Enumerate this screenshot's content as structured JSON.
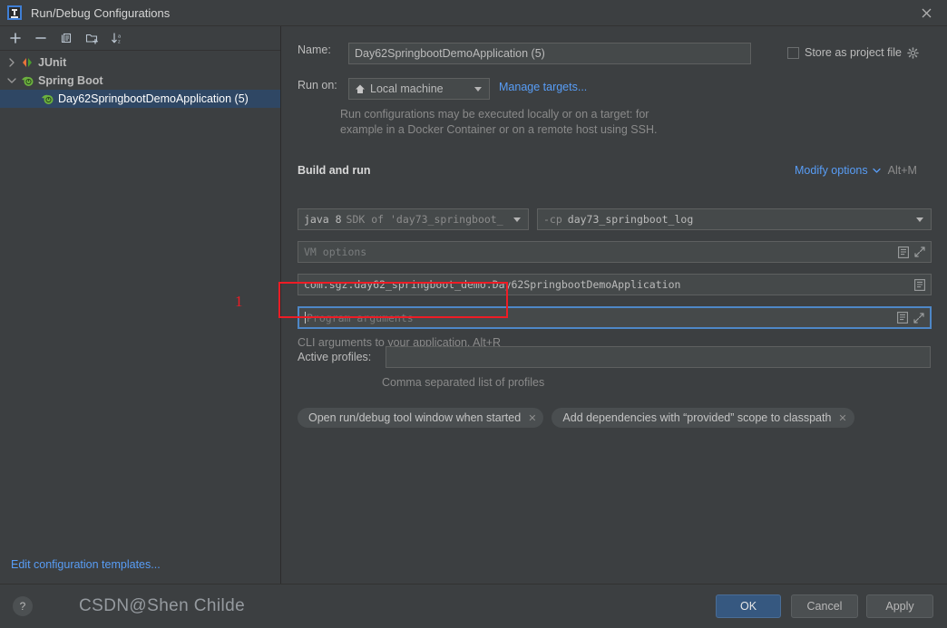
{
  "window": {
    "title": "Run/Debug Configurations",
    "logo_icon": "intellij-idea-icon",
    "close_icon": "close-icon"
  },
  "sidebar": {
    "toolbar": [
      {
        "name": "add-configuration-button",
        "icon": "plus-icon",
        "label": "+"
      },
      {
        "name": "remove-configuration-button",
        "icon": "minus-icon",
        "label": "−"
      },
      {
        "name": "copy-configuration-button",
        "icon": "copy-icon",
        "label": ""
      },
      {
        "name": "move-into-folder-button",
        "icon": "new-folder-icon",
        "label": ""
      },
      {
        "name": "sort-configurations-button",
        "icon": "sort-az-icon",
        "label": ""
      }
    ],
    "tree": [
      {
        "label": "JUnit",
        "icon": "junit-icon",
        "expanded": false,
        "twisty": "›",
        "level": 0,
        "selected": false
      },
      {
        "label": "Spring Boot",
        "icon": "spring-boot-icon",
        "expanded": true,
        "twisty": "⌄",
        "level": 0,
        "selected": false
      },
      {
        "label": "Day62SpringbootDemoApplication (5)",
        "icon": "spring-boot-icon",
        "expanded": null,
        "twisty": "",
        "level": 1,
        "selected": true
      }
    ],
    "edit_templates_link": "Edit configuration templates..."
  },
  "form": {
    "name_label": "Name:",
    "name_value": "Day62SpringbootDemoApplication (5)",
    "store_as_project_file_label": "Store as project file",
    "store_as_project_file_checked": false,
    "store_gear_icon": "gear-icon",
    "run_on_label": "Run on:",
    "run_on_value": "Local machine",
    "run_on_icon": "home-icon",
    "manage_targets_link": "Manage targets...",
    "run_on_hint_line1": "Run configurations may be executed locally or on a target: for",
    "run_on_hint_line2": "example in a Docker Container or on a remote host using SSH.",
    "build_and_run_title": "Build and run",
    "modify_options_link": "Modify options",
    "modify_options_shortcut": "Alt+M",
    "sdk_value_prefix": "java 8",
    "sdk_value_suffix": "SDK of 'day73_springboot_",
    "classpath_prefix": "-cp",
    "classpath_value": "day73_springboot_log",
    "vm_options_placeholder": "VM options",
    "vm_options_value": "",
    "main_class_value": "com.sgz.day62_springboot_demo.Day62SpringbootDemoApplication",
    "program_arguments_placeholder": "Program arguments",
    "program_arguments_value": "",
    "program_arguments_hint": "CLI arguments to your application. Alt+R",
    "active_profiles_label": "Active profiles:",
    "active_profiles_value": "",
    "active_profiles_hint": "Comma separated list of profiles",
    "chips": [
      {
        "label": "Open run/debug tool window when started",
        "close_icon": "close-small-icon"
      },
      {
        "label": "Add dependencies with “provided” scope to classpath",
        "close_icon": "close-small-icon"
      }
    ],
    "macro_icon": "macro-list-icon",
    "expand_icon": "expand-diagonal-icon"
  },
  "annotation": {
    "number": "1",
    "color": "#ee1c25"
  },
  "footer": {
    "help_label": "?",
    "ok_label": "OK",
    "cancel_label": "Cancel",
    "apply_label": "Apply"
  },
  "watermark": {
    "text": "CSDN@Shen Childe"
  },
  "colors": {
    "background": "#3c3f41",
    "field_background": "#45494a",
    "selection": "#2f4764",
    "link": "#589df6",
    "primary_button": "#365880",
    "annotation_red": "#ee1c25"
  }
}
